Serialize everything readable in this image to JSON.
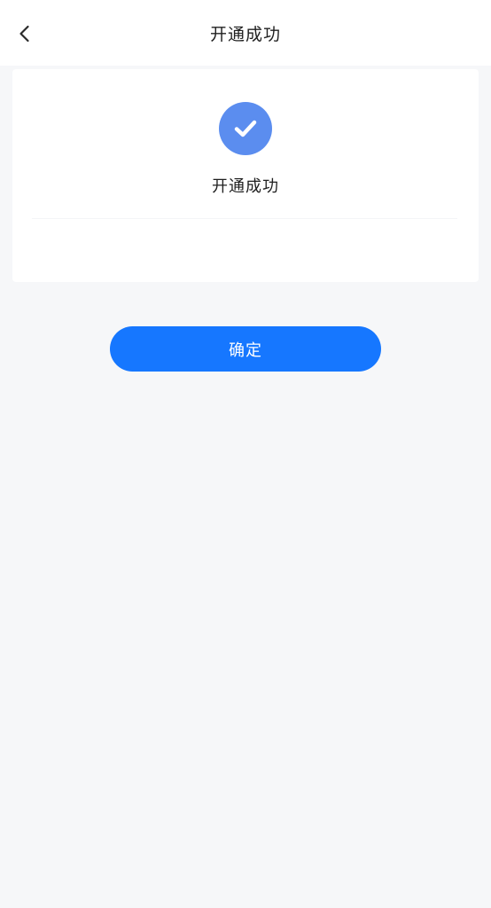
{
  "header": {
    "title": "开通成功",
    "back_icon": "chevron-left-icon"
  },
  "result": {
    "icon": "check-circle-icon",
    "message": "开通成功"
  },
  "actions": {
    "confirm_label": "确定"
  },
  "colors": {
    "accent": "#1677ff",
    "success_icon": "#5b8def",
    "background": "#f6f7f9",
    "surface": "#ffffff"
  }
}
